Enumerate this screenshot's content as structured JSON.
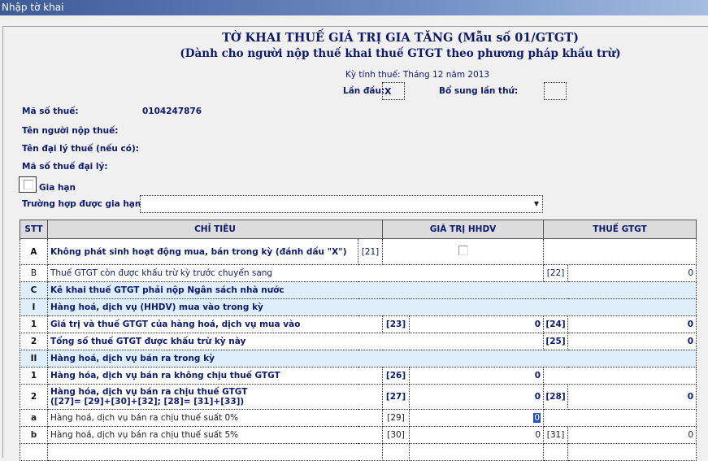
{
  "window": {
    "title": "Nhập tờ khai"
  },
  "form": {
    "title": "TỜ KHAI THUẾ GIÁ TRỊ GIA TĂNG (Mẫu số 01/GTGT)",
    "subtitle": "(Dành cho người nộp thuế khai thuế GTGT theo phương pháp khấu trừ)",
    "period": "Kỳ tính thuế: Tháng 12 năm 2013",
    "first_time_label": "Lần đầu:",
    "first_time_value": "X",
    "supplement_label": "Bổ sung lần thứ:",
    "supplement_value": "",
    "tax_code_label": "Mã số thuế:",
    "tax_code_value": "0104247876",
    "taxpayer_label": "Tên người nộp thuế:",
    "agent_label": "Tên đại lý thuế (nếu có):",
    "agent_code_label": "Mã số thuế đại lý:",
    "extension_label": "Gia hạn",
    "extension_checked": false,
    "extension_case_label": "Trường hợp được gia hạn:",
    "extension_case_value": ""
  },
  "table": {
    "headers": [
      "STT",
      "CHỈ TIÊU",
      "GIÁ TRỊ HHDV",
      "THUẾ GTGT"
    ],
    "rows": [
      {
        "type": "A",
        "stt": "A",
        "label": "Không phát sinh hoạt động mua, bán trong kỳ (đánh dấu \"X\")",
        "code1": "[21]",
        "checked": false
      },
      {
        "type": "tax",
        "stt": "B",
        "label": "Thuế GTGT còn được khấu trừ kỳ trước chuyển sang",
        "code2": "[22]",
        "val2": "0",
        "normal": true
      },
      {
        "type": "sec",
        "stt": "C",
        "label": "Kê khai thuế GTGT phải nộp Ngân sách nhà nước"
      },
      {
        "type": "sec",
        "stt": "I",
        "label": "Hàng hoá, dịch vụ (HHDV) mua vào trong kỳ"
      },
      {
        "type": "both",
        "stt": "1",
        "label": "Giá trị và thuế GTGT của hàng hoá, dịch vụ mua vào",
        "code1": "[23]",
        "val1": "0",
        "code2": "[24]",
        "val2": "0",
        "bold": true
      },
      {
        "type": "tax",
        "stt": "2",
        "label": "Tổng số thuế GTGT  được khấu trừ kỳ này",
        "code2": "[25]",
        "val2": "0",
        "bold": true
      },
      {
        "type": "sec",
        "stt": "II",
        "label": "Hàng hoá, dịch vụ bán ra trong kỳ"
      },
      {
        "type": "value",
        "stt": "1",
        "label": "Hàng hóa, dịch vụ bán ra không chịu thuế GTGT",
        "code1": "[26]",
        "val1": "0",
        "bold": true
      },
      {
        "type": "both",
        "stt": "2",
        "label": "Hàng hóa, dịch vụ bán ra chịu thuế GTGT",
        "label2": " ([27]= [29]+[30]+[32]; [28]= [31]+[33])",
        "code1": "[27]",
        "val1": "0",
        "code2": "[28]",
        "val2": "0",
        "bold": true,
        "tall": true
      },
      {
        "type": "value",
        "stt": "a",
        "label": "Hàng hoá, dịch vụ bán ra chịu thuế suất 0%",
        "code1": "[29]",
        "val1": "0",
        "selected": true
      },
      {
        "type": "both",
        "stt": "b",
        "label": "Hàng hoá, dịch vụ bán ra chịu thuế suất 5%",
        "code1": "[30]",
        "val1": "0",
        "code2": "[31]",
        "val2": "0"
      },
      {
        "type": "partial",
        "stt": "",
        "label": ""
      }
    ]
  }
}
